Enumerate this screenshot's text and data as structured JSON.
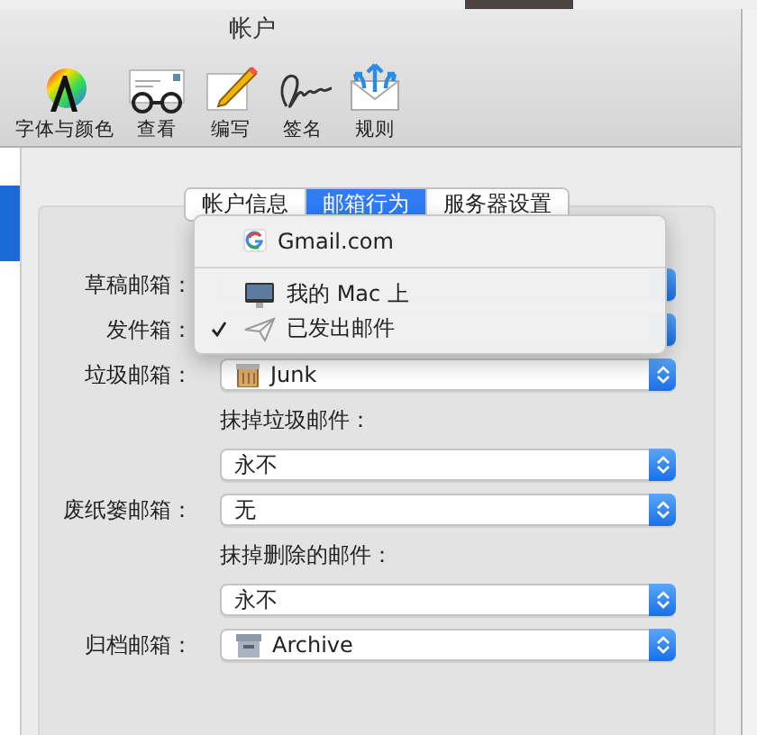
{
  "window": {
    "title": "帐户"
  },
  "toolbar": [
    {
      "label": "字体与颜色",
      "selected": false
    },
    {
      "label": "查看",
      "selected": false
    },
    {
      "label": "编写",
      "selected": false
    },
    {
      "label": "签名",
      "selected": false
    },
    {
      "label": "规则",
      "selected": false
    }
  ],
  "tabs": [
    {
      "label": "帐户信息",
      "selected": false
    },
    {
      "label": "邮箱行为",
      "selected": true
    },
    {
      "label": "服务器设置",
      "selected": false
    }
  ],
  "fields": [
    {
      "kind": "popup",
      "label": "草稿邮箱："
    },
    {
      "kind": "popup",
      "label": "发件箱："
    },
    {
      "kind": "popup",
      "label": "垃圾邮箱：",
      "value": "Junk"
    },
    {
      "kind": "caption",
      "text": "抹掉垃圾邮件："
    },
    {
      "kind": "popup",
      "value": "永不"
    },
    {
      "kind": "popup",
      "label": "废纸篓邮箱：",
      "value": "无"
    },
    {
      "kind": "caption",
      "text": "抹掉删除的邮件："
    },
    {
      "kind": "popup",
      "value": "永不"
    },
    {
      "kind": "popup",
      "label": "归档邮箱：",
      "value": "Archive"
    }
  ],
  "menu": [
    {
      "kind": "account",
      "text": "Gmail.com",
      "checked": false
    },
    {
      "kind": "separator"
    },
    {
      "kind": "location",
      "text": "我的 Mac 上",
      "checked": false
    },
    {
      "kind": "mailbox",
      "text": "已发出邮件",
      "checked": true
    }
  ]
}
